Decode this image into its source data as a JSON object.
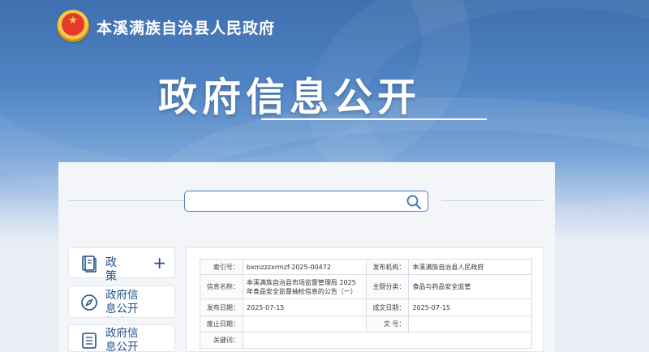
{
  "header": {
    "site_name": "本溪满族自治县人民政府",
    "hero_title": "政府信息公开"
  },
  "search": {
    "placeholder": "",
    "value": ""
  },
  "sidebar": {
    "items": [
      {
        "label": "政　策",
        "icon": "book-icon",
        "expander": "+"
      },
      {
        "label": "政府信息公开指南",
        "icon": "compass-icon"
      },
      {
        "label": "政府信息公开制度",
        "icon": "list-doc-icon"
      }
    ]
  },
  "meta_table": {
    "rows": [
      {
        "k1": "索引号：",
        "v1": "bxmzzzxrmzf-2025-00472",
        "k2": "发布机构：",
        "v2": "本溪满族自治县人民政府"
      },
      {
        "k1": "信息名称：",
        "v1": "本溪满族自治县市场监督管理局 2025年食品安全监督抽检信息的公告（一）",
        "k2": "主题分类：",
        "v2": "食品与药品安全监管"
      },
      {
        "k1": "发布日期：",
        "v1": "2025-07-15",
        "k2": "成文日期：",
        "v2": "2025-07-15"
      },
      {
        "k1": "废止日期：",
        "v1": "",
        "k2": "文 号：",
        "v2": ""
      },
      {
        "k1": "关键词：",
        "v1": ""
      }
    ]
  },
  "colors": {
    "brand_blue": "#1f4f8b",
    "hero_top": "#3f6fae",
    "search_border": "#4a7fc3"
  }
}
